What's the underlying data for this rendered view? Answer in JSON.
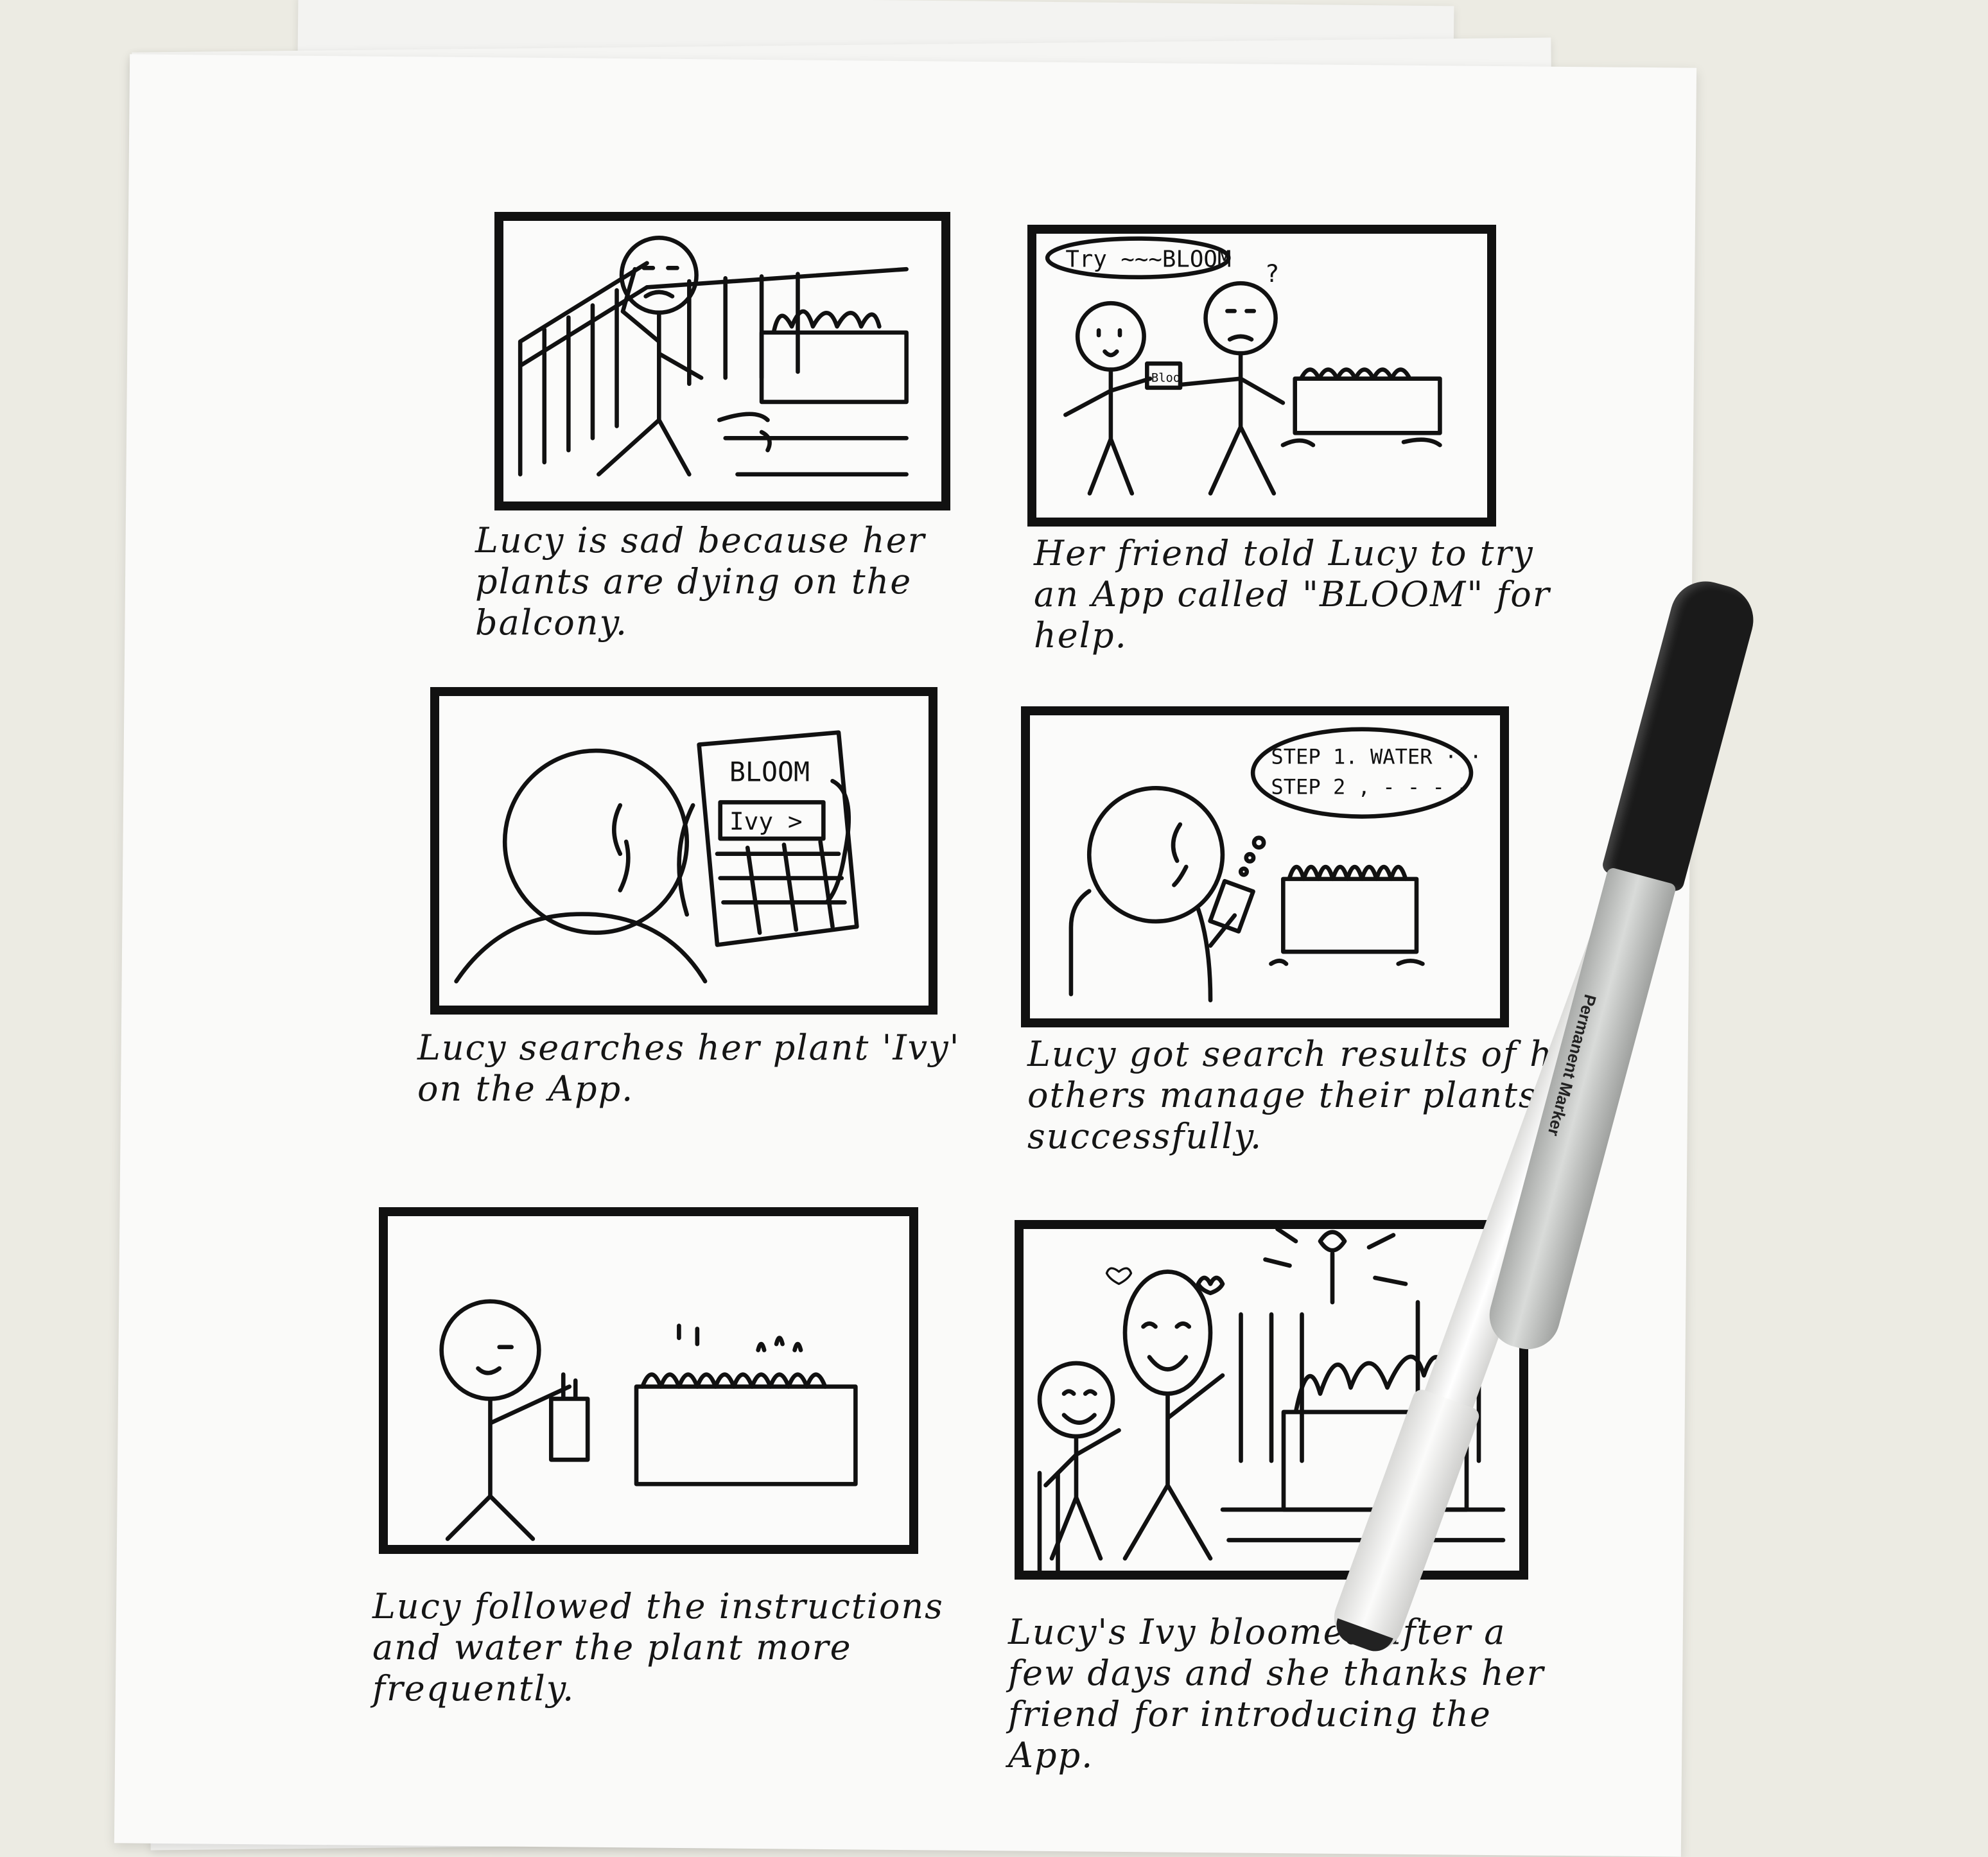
{
  "panels": [
    {
      "caption": "Lucy is sad because her\nplants are dying on the balcony."
    },
    {
      "speech": "Try ~~~BLOOM",
      "question": "?",
      "phone_text": "Bloo",
      "caption": "Her friend told Lucy to try\nan App called \"BLOOM\" for help."
    },
    {
      "app_title": "BLOOM",
      "search_text": "Ivy >",
      "caption": "Lucy searches her plant 'Ivy'\non the App."
    },
    {
      "thought_line1": "STEP 1. WATER ···",
      "thought_line2": "STEP 2 , - - - -",
      "caption": "Lucy got search results of how\nothers manage their plants successfully."
    },
    {
      "caption": "Lucy followed the instructions\nand water the plant more frequently."
    },
    {
      "caption": "Lucy's Ivy bloomed after a\nfew days and she thanks her\nfriend for introducing the App."
    }
  ],
  "marker_label": "Permanent Marker"
}
